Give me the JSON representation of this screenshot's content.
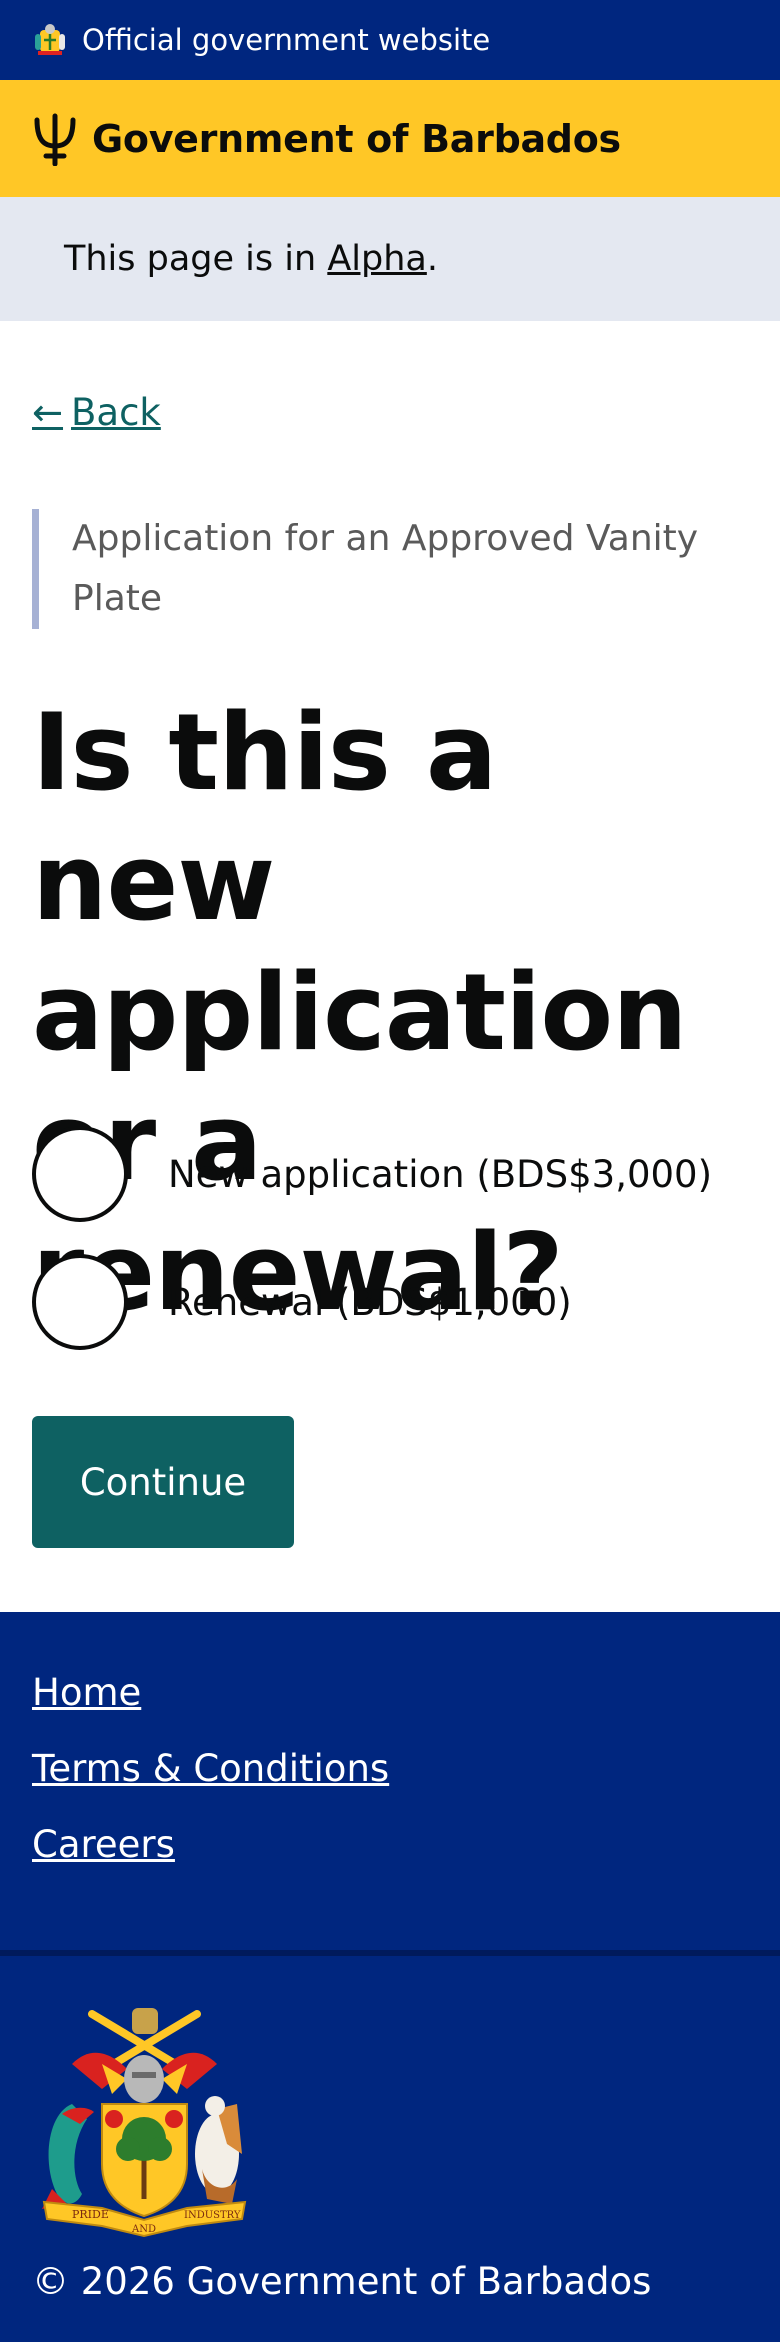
{
  "official_bar": {
    "text": "Official government website",
    "crest_icon": "coat-of-arms-icon"
  },
  "header": {
    "title": "Government of Barbados",
    "logo_icon": "trident-icon"
  },
  "phase_banner": {
    "prefix": "This page is in ",
    "link": "Alpha",
    "suffix": "."
  },
  "back_link": {
    "arrow": "←",
    "label": "Back"
  },
  "caption": "Application for an Approved Vanity Plate",
  "heading": "Is this a new application or a renewal?",
  "options": [
    {
      "label": "New application (BDS$3,000)",
      "selected": false
    },
    {
      "label": "Renewal (BDS$1,000)",
      "selected": false
    }
  ],
  "continue_label": "Continue",
  "footer": {
    "links": [
      "Home",
      "Terms & Conditions",
      "Careers"
    ],
    "crest_motto": [
      "PRIDE",
      "AND",
      "INDUSTRY"
    ],
    "copyright": "© 2026 Government of Barbados"
  },
  "colors": {
    "official_bar": "#00267f",
    "header": "#ffc726",
    "phase_banner": "#e4e8f1",
    "link_teal": "#0e6162",
    "button": "#0e6162",
    "footer": "#00267f"
  }
}
